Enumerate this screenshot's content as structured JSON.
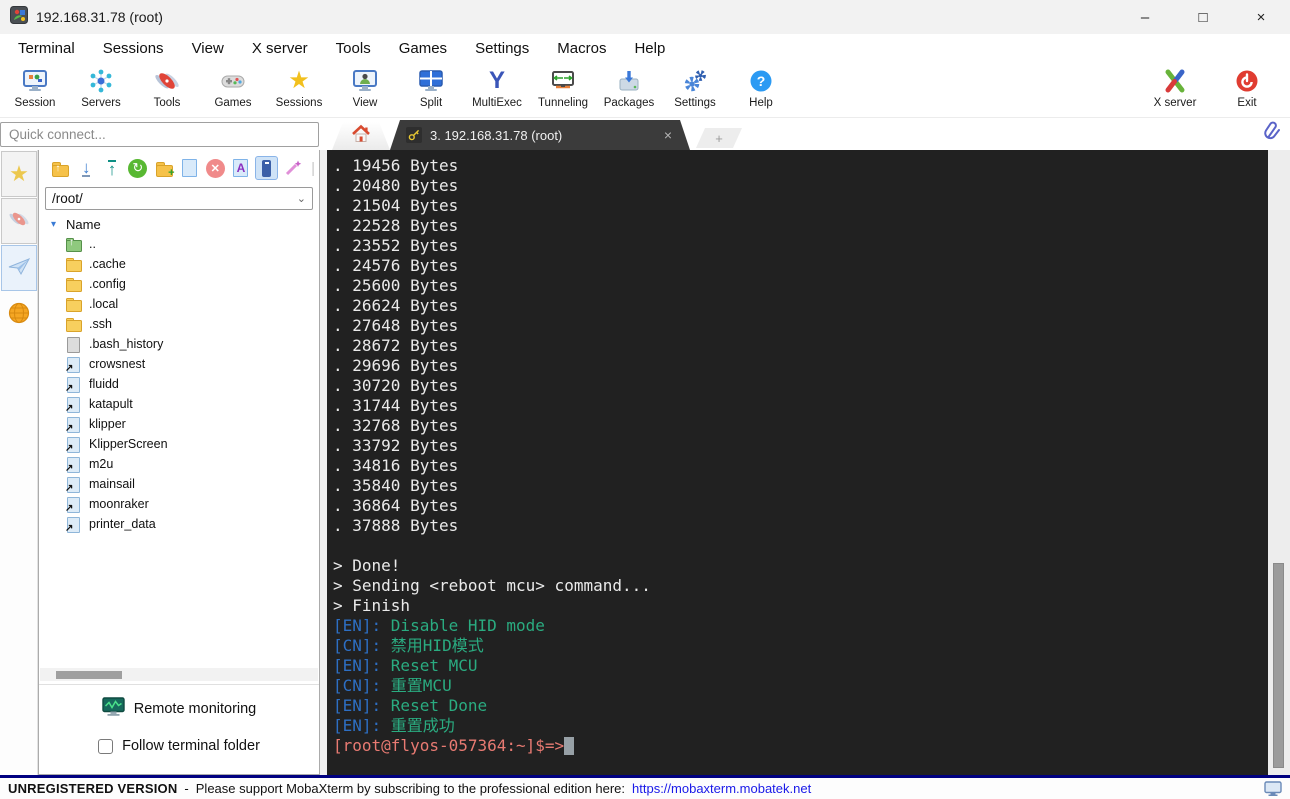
{
  "window": {
    "title": "192.168.31.78 (root)",
    "controls": {
      "minimize": "–",
      "maximize": "□",
      "close": "×"
    }
  },
  "menu": {
    "items": [
      "Terminal",
      "Sessions",
      "View",
      "X server",
      "Tools",
      "Games",
      "Settings",
      "Macros",
      "Help"
    ]
  },
  "toolbar": {
    "items": [
      "Session",
      "Servers",
      "Tools",
      "Games",
      "Sessions",
      "View",
      "Split",
      "MultiExec",
      "Tunneling",
      "Packages",
      "Settings",
      "Help"
    ],
    "right": [
      "X server",
      "Exit"
    ]
  },
  "quick_connect": {
    "placeholder": "Quick connect..."
  },
  "tabs": {
    "active_label": "3. 192.168.31.78 (root)",
    "close": "×",
    "new_tab": "+"
  },
  "file_browser": {
    "path": "/root/",
    "column_header": "Name",
    "items": [
      {
        "name": "..",
        "type": "up"
      },
      {
        "name": ".cache",
        "type": "folder"
      },
      {
        "name": ".config",
        "type": "folder"
      },
      {
        "name": ".local",
        "type": "folder"
      },
      {
        "name": ".ssh",
        "type": "folder"
      },
      {
        "name": ".bash_history",
        "type": "file"
      },
      {
        "name": "crowsnest",
        "type": "link"
      },
      {
        "name": "fluidd",
        "type": "link"
      },
      {
        "name": "katapult",
        "type": "link"
      },
      {
        "name": "klipper",
        "type": "link"
      },
      {
        "name": "KlipperScreen",
        "type": "link"
      },
      {
        "name": "m2u",
        "type": "link"
      },
      {
        "name": "mainsail",
        "type": "link"
      },
      {
        "name": "moonraker",
        "type": "link"
      },
      {
        "name": "printer_data",
        "type": "link"
      }
    ],
    "remote_monitoring_label": "Remote monitoring",
    "follow_terminal_folder_label": "Follow terminal folder",
    "follow_checked": false
  },
  "terminal": {
    "bg": "#212121",
    "palette": {
      "fg": "#eaeaea",
      "blue": "#2d6fc4",
      "green": "#2aab80",
      "prompt": "#e87a72",
      "cursor": "#97a0a6"
    },
    "lines": [
      [
        {
          "t": ". 19456 Bytes",
          "c": "fg"
        }
      ],
      [
        {
          "t": ". 20480 Bytes",
          "c": "fg"
        }
      ],
      [
        {
          "t": ". 21504 Bytes",
          "c": "fg"
        }
      ],
      [
        {
          "t": ". 22528 Bytes",
          "c": "fg"
        }
      ],
      [
        {
          "t": ". 23552 Bytes",
          "c": "fg"
        }
      ],
      [
        {
          "t": ". 24576 Bytes",
          "c": "fg"
        }
      ],
      [
        {
          "t": ". 25600 Bytes",
          "c": "fg"
        }
      ],
      [
        {
          "t": ". 26624 Bytes",
          "c": "fg"
        }
      ],
      [
        {
          "t": ". 27648 Bytes",
          "c": "fg"
        }
      ],
      [
        {
          "t": ". 28672 Bytes",
          "c": "fg"
        }
      ],
      [
        {
          "t": ". 29696 Bytes",
          "c": "fg"
        }
      ],
      [
        {
          "t": ". 30720 Bytes",
          "c": "fg"
        }
      ],
      [
        {
          "t": ". 31744 Bytes",
          "c": "fg"
        }
      ],
      [
        {
          "t": ". 32768 Bytes",
          "c": "fg"
        }
      ],
      [
        {
          "t": ". 33792 Bytes",
          "c": "fg"
        }
      ],
      [
        {
          "t": ". 34816 Bytes",
          "c": "fg"
        }
      ],
      [
        {
          "t": ". 35840 Bytes",
          "c": "fg"
        }
      ],
      [
        {
          "t": ". 36864 Bytes",
          "c": "fg"
        }
      ],
      [
        {
          "t": ". 37888 Bytes",
          "c": "fg"
        }
      ],
      [],
      [
        {
          "t": "> Done!",
          "c": "fg"
        }
      ],
      [
        {
          "t": "> Sending <reboot mcu> command...",
          "c": "fg"
        }
      ],
      [
        {
          "t": "> Finish",
          "c": "fg"
        }
      ],
      [
        {
          "t": "[EN]: ",
          "c": "blue"
        },
        {
          "t": "Disable HID mode",
          "c": "green"
        }
      ],
      [
        {
          "t": "[CN]: ",
          "c": "blue"
        },
        {
          "t": "禁用HID模式",
          "c": "green"
        }
      ],
      [
        {
          "t": "[EN]: ",
          "c": "blue"
        },
        {
          "t": "Reset MCU",
          "c": "green"
        }
      ],
      [
        {
          "t": "[CN]: ",
          "c": "blue"
        },
        {
          "t": "重置MCU",
          "c": "green"
        }
      ],
      [
        {
          "t": "[EN]: ",
          "c": "blue"
        },
        {
          "t": "Reset Done",
          "c": "green"
        }
      ],
      [
        {
          "t": "[EN]: ",
          "c": "blue"
        },
        {
          "t": "重置成功",
          "c": "green"
        }
      ],
      [
        {
          "t": "[root@flyos-057364:~]$=>",
          "c": "prompt"
        },
        {
          "t": " ",
          "c": "cursor"
        }
      ]
    ]
  },
  "status_bar": {
    "version": "UNREGISTERED VERSION",
    "separator": "-",
    "message": "Please support MobaXterm by subscribing to the professional edition here:",
    "link": "https://mobaxterm.mobatek.net"
  }
}
